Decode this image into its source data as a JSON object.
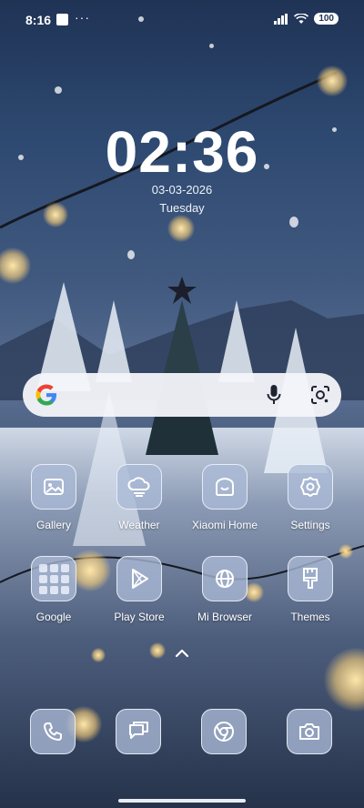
{
  "status_bar": {
    "time": "8:16",
    "overflow": "···",
    "battery": "100"
  },
  "clock": {
    "time": "02:36",
    "date": "03-03-2026",
    "day": "Tuesday"
  },
  "search": {
    "logo_letter": "G"
  },
  "apps": [
    {
      "label": "Gallery",
      "icon": "gallery-icon"
    },
    {
      "label": "Weather",
      "icon": "weather-icon"
    },
    {
      "label": "Xiaomi Home",
      "icon": "xiaomi-home-icon"
    },
    {
      "label": "Settings",
      "icon": "settings-gear-icon"
    },
    {
      "label": "Google",
      "icon": "google-folder-icon"
    },
    {
      "label": "Play Store",
      "icon": "play-store-icon"
    },
    {
      "label": "Mi Browser",
      "icon": "globe-icon"
    },
    {
      "label": "Themes",
      "icon": "paint-brush-icon"
    }
  ],
  "dock": [
    {
      "icon": "phone-icon"
    },
    {
      "icon": "messages-icon"
    },
    {
      "icon": "chrome-icon"
    },
    {
      "icon": "camera-icon"
    }
  ],
  "colors": {
    "tile_bg": "#aabad6",
    "tile_border": "#f0f4fc",
    "search_bg": "#f4f6fa"
  }
}
